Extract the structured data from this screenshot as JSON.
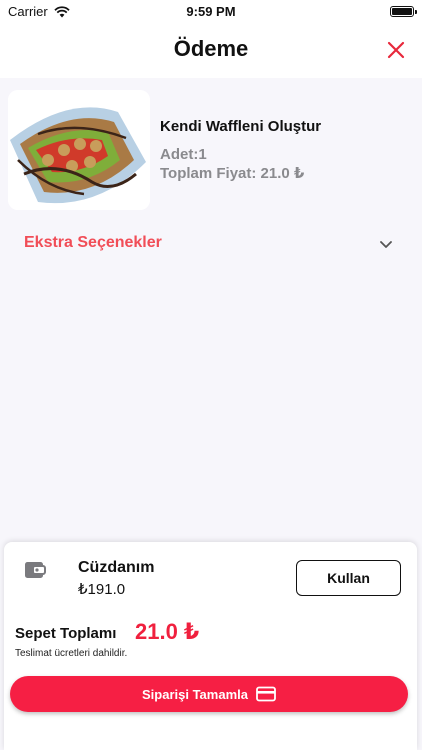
{
  "status_bar": {
    "carrier": "Carrier",
    "time": "9:59 PM"
  },
  "nav": {
    "title": "Ödeme",
    "close_icon": "close-icon"
  },
  "product": {
    "name": "Kendi Waffleni Oluştur",
    "quantity": "Adet:1",
    "total_price": "Toplam Fiyat: 21.0 ₺",
    "image_alt": "waffle"
  },
  "extras": {
    "label": "Ekstra Seçenekler",
    "icon": "chevron-down-icon"
  },
  "wallet": {
    "title": "Cüzdanım",
    "balance": "₺191.0",
    "use_button": "Kullan",
    "icon": "wallet-icon"
  },
  "cart": {
    "total_label": "Sepet Toplamı",
    "total_value": "21.0 ₺",
    "delivery_note": "Teslimat ücretleri dahildir."
  },
  "checkout": {
    "button_label": "Siparişi Tamamla",
    "icon": "credit-card-icon"
  },
  "colors": {
    "accent": "#f61f44",
    "extras_text": "#f14d57",
    "total_text": "#f0203e",
    "muted": "#8a8a8e"
  }
}
